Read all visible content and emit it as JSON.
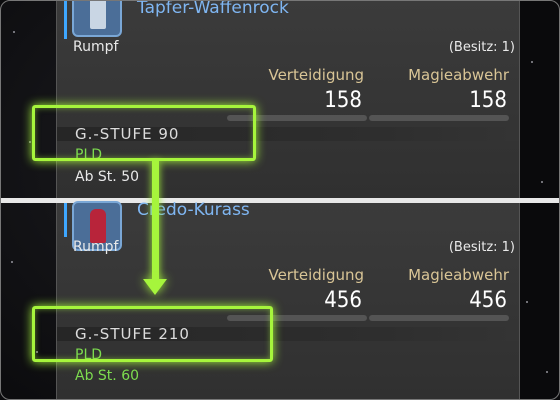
{
  "items": [
    {
      "name": "Tapfer-Waffenrock",
      "slot": "Rumpf",
      "owned": "(Besitz: 1)",
      "stats": [
        {
          "label": "Verteidigung",
          "value": "158"
        },
        {
          "label": "Magieabwehr",
          "value": "158"
        }
      ],
      "item_level": "G.-STUFE 90",
      "job": "PLD",
      "required_level": "Ab St. 50",
      "required_level_color": "#e9e9e9",
      "icon": "armor-icon"
    },
    {
      "name": "Credo-Kurass",
      "slot": "Rumpf",
      "owned": "(Besitz: 1)",
      "stats": [
        {
          "label": "Verteidigung",
          "value": "456"
        },
        {
          "label": "Magieabwehr",
          "value": "456"
        }
      ],
      "item_level": "G.-STUFE 210",
      "job": "PLD",
      "required_level": "Ab St. 60",
      "required_level_color": "#7ddc4f",
      "icon": "armor-icon"
    }
  ],
  "colors": {
    "highlight": "#a6f53c",
    "item_name": "#7fb6f2",
    "stat_label": "#d9c596",
    "job": "#7ddc4f"
  }
}
